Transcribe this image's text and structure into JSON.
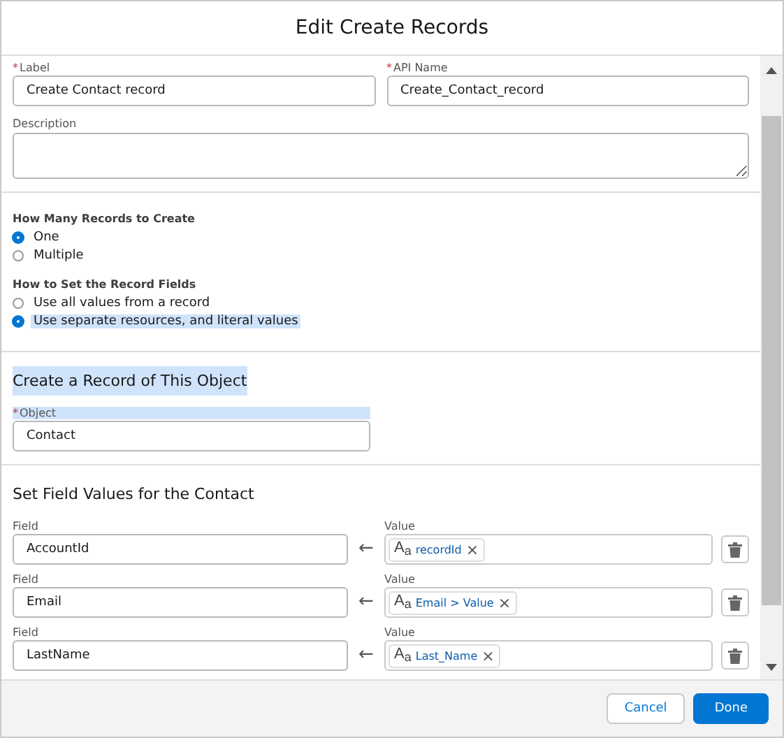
{
  "window": {
    "title": "Edit Create Records"
  },
  "label_field": {
    "required_mark": "*",
    "label": "Label",
    "value": "Create Contact record"
  },
  "api_name_field": {
    "required_mark": "*",
    "label": "API Name",
    "value": "Create_Contact_record"
  },
  "description_field": {
    "label": "Description"
  },
  "record_count": {
    "title": "How Many Records to Create",
    "options": [
      {
        "label": "One",
        "selected": true,
        "highlighted": false
      },
      {
        "label": "Multiple",
        "selected": false,
        "highlighted": false
      }
    ]
  },
  "field_mode": {
    "title": "How to Set the Record Fields",
    "options": [
      {
        "label": "Use all values from a record",
        "selected": false,
        "highlighted": false
      },
      {
        "label": "Use separate resources, and literal values",
        "selected": true,
        "highlighted": true
      }
    ]
  },
  "object_section": {
    "title": "Create a Record of This Object",
    "highlighted": true,
    "object_field": {
      "required_mark": "*",
      "label": "Object",
      "value": "Contact",
      "highlighted": true
    }
  },
  "field_values": {
    "title": "Set Field Values for the Contact",
    "rows": [
      {
        "field_label": "Field",
        "field": "AccountId",
        "arrow": "←",
        "value_label": "Value",
        "type_icon": "A$_{a}$",
        "value": "recordId",
        "remove": "×"
      },
      {
        "field_label": "Field",
        "field": "Email",
        "arrow": "←",
        "value_label": "Value",
        "type_icon": "A$_{a}$",
        "value": "Email > Value",
        "remove": "×"
      },
      {
        "field_label": "Field",
        "field": "LastName",
        "arrow": "←",
        "value_label": "Value",
        "type_icon": "A$_{a}$",
        "value": "Last_Name",
        "remove": "×"
      }
    ]
  },
  "footer": {
    "buttons": [
      {
        "label": "Cancel",
        "kind": "neutral"
      },
      {
        "label": "Done",
        "kind": "brand"
      }
    ]
  }
}
